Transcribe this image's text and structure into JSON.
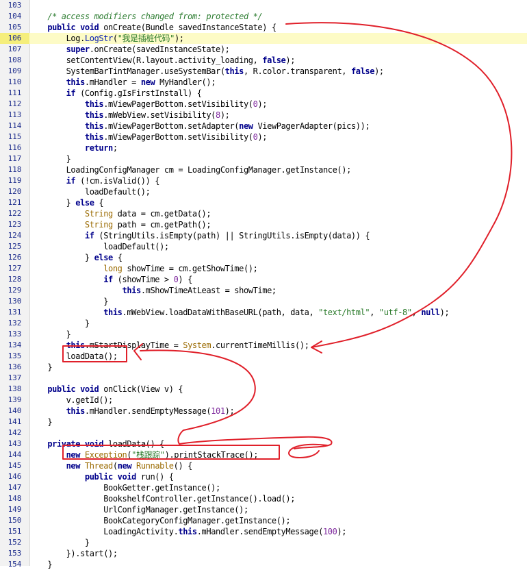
{
  "editor": {
    "highlighted_line": 106,
    "colors": {
      "annotation_red": "#e0202a",
      "highlight_line": "#fdfbc6",
      "keyword": "#00008b",
      "string": "#2a7a2a",
      "number": "#7f2a9e",
      "comment": "#2e7d32"
    },
    "lines": [
      {
        "n": "103",
        "indent": "",
        "tokens": []
      },
      {
        "n": "104",
        "indent": "    ",
        "tokens": [
          {
            "t": "/* access modifiers changed from: protected */",
            "c": "comment"
          }
        ]
      },
      {
        "n": "105",
        "indent": "    ",
        "tokens": [
          {
            "t": "public void",
            "c": "kw"
          },
          {
            "t": " onCreate(Bundle savedInstanceState) {",
            "c": "plain"
          }
        ]
      },
      {
        "n": "106",
        "indent": "        ",
        "tokens": [
          {
            "t": "Log.",
            "c": "plain"
          },
          {
            "t": "LogStr",
            "c": "field"
          },
          {
            "t": "(",
            "c": "plain"
          },
          {
            "t": "\"我是插桩代码\"",
            "c": "string"
          },
          {
            "t": ");",
            "c": "plain"
          }
        ]
      },
      {
        "n": "107",
        "indent": "        ",
        "tokens": [
          {
            "t": "super",
            "c": "kw"
          },
          {
            "t": ".onCreate(savedInstanceState);",
            "c": "plain"
          }
        ]
      },
      {
        "n": "108",
        "indent": "        ",
        "tokens": [
          {
            "t": "setContentView(R.layout.activity_loading, ",
            "c": "plain"
          },
          {
            "t": "false",
            "c": "kw"
          },
          {
            "t": ");",
            "c": "plain"
          }
        ]
      },
      {
        "n": "109",
        "indent": "        ",
        "tokens": [
          {
            "t": "SystemBarTintManager.useSystemBar(",
            "c": "plain"
          },
          {
            "t": "this",
            "c": "kw"
          },
          {
            "t": ", R.color.transparent, ",
            "c": "plain"
          },
          {
            "t": "false",
            "c": "kw"
          },
          {
            "t": ");",
            "c": "plain"
          }
        ]
      },
      {
        "n": "110",
        "indent": "        ",
        "tokens": [
          {
            "t": "this",
            "c": "kw"
          },
          {
            "t": ".mHandler = ",
            "c": "plain"
          },
          {
            "t": "new",
            "c": "kw"
          },
          {
            "t": " MyHandler();",
            "c": "plain"
          }
        ]
      },
      {
        "n": "111",
        "indent": "        ",
        "tokens": [
          {
            "t": "if",
            "c": "kw"
          },
          {
            "t": " (Config.gIsFirstInstall) {",
            "c": "plain"
          }
        ]
      },
      {
        "n": "112",
        "indent": "            ",
        "tokens": [
          {
            "t": "this",
            "c": "kw"
          },
          {
            "t": ".mViewPagerBottom.setVisibility(",
            "c": "plain"
          },
          {
            "t": "0",
            "c": "number"
          },
          {
            "t": ");",
            "c": "plain"
          }
        ]
      },
      {
        "n": "113",
        "indent": "            ",
        "tokens": [
          {
            "t": "this",
            "c": "kw"
          },
          {
            "t": ".mWebView.setVisibility(",
            "c": "plain"
          },
          {
            "t": "8",
            "c": "number"
          },
          {
            "t": ");",
            "c": "plain"
          }
        ]
      },
      {
        "n": "114",
        "indent": "            ",
        "tokens": [
          {
            "t": "this",
            "c": "kw"
          },
          {
            "t": ".mViewPagerBottom.setAdapter(",
            "c": "plain"
          },
          {
            "t": "new",
            "c": "kw"
          },
          {
            "t": " ViewPagerAdapter(pics));",
            "c": "plain"
          }
        ]
      },
      {
        "n": "115",
        "indent": "            ",
        "tokens": [
          {
            "t": "this",
            "c": "kw"
          },
          {
            "t": ".mViewPagerBottom.setVisibility(",
            "c": "plain"
          },
          {
            "t": "0",
            "c": "number"
          },
          {
            "t": ");",
            "c": "plain"
          }
        ]
      },
      {
        "n": "116",
        "indent": "            ",
        "tokens": [
          {
            "t": "return",
            "c": "kw"
          },
          {
            "t": ";",
            "c": "plain"
          }
        ]
      },
      {
        "n": "117",
        "indent": "        ",
        "tokens": [
          {
            "t": "}",
            "c": "plain"
          }
        ]
      },
      {
        "n": "118",
        "indent": "        ",
        "tokens": [
          {
            "t": "LoadingConfigManager cm = LoadingConfigManager.getInstance();",
            "c": "plain"
          }
        ]
      },
      {
        "n": "119",
        "indent": "        ",
        "tokens": [
          {
            "t": "if",
            "c": "kw"
          },
          {
            "t": " (!cm.isValid()) {",
            "c": "plain"
          }
        ]
      },
      {
        "n": "120",
        "indent": "            ",
        "tokens": [
          {
            "t": "loadDefault();",
            "c": "plain"
          }
        ]
      },
      {
        "n": "121",
        "indent": "        ",
        "tokens": [
          {
            "t": "} ",
            "c": "plain"
          },
          {
            "t": "else",
            "c": "kw"
          },
          {
            "t": " {",
            "c": "plain"
          }
        ]
      },
      {
        "n": "122",
        "indent": "            ",
        "tokens": [
          {
            "t": "String",
            "c": "type"
          },
          {
            "t": " data = cm.getData();",
            "c": "plain"
          }
        ]
      },
      {
        "n": "123",
        "indent": "            ",
        "tokens": [
          {
            "t": "String",
            "c": "type"
          },
          {
            "t": " path = cm.getPath();",
            "c": "plain"
          }
        ]
      },
      {
        "n": "124",
        "indent": "            ",
        "tokens": [
          {
            "t": "if",
            "c": "kw"
          },
          {
            "t": " (StringUtils.isEmpty(path) || StringUtils.isEmpty(data)) {",
            "c": "plain"
          }
        ]
      },
      {
        "n": "125",
        "indent": "                ",
        "tokens": [
          {
            "t": "loadDefault();",
            "c": "plain"
          }
        ]
      },
      {
        "n": "126",
        "indent": "            ",
        "tokens": [
          {
            "t": "} ",
            "c": "plain"
          },
          {
            "t": "else",
            "c": "kw"
          },
          {
            "t": " {",
            "c": "plain"
          }
        ]
      },
      {
        "n": "127",
        "indent": "                ",
        "tokens": [
          {
            "t": "long",
            "c": "type"
          },
          {
            "t": " showTime = cm.getShowTime();",
            "c": "plain"
          }
        ]
      },
      {
        "n": "128",
        "indent": "                ",
        "tokens": [
          {
            "t": "if",
            "c": "kw"
          },
          {
            "t": " (showTime > ",
            "c": "plain"
          },
          {
            "t": "0",
            "c": "number"
          },
          {
            "t": ") {",
            "c": "plain"
          }
        ]
      },
      {
        "n": "129",
        "indent": "                    ",
        "tokens": [
          {
            "t": "this",
            "c": "kw"
          },
          {
            "t": ".mShowTimeAtLeast = showTime;",
            "c": "plain"
          }
        ]
      },
      {
        "n": "130",
        "indent": "                ",
        "tokens": [
          {
            "t": "}",
            "c": "plain"
          }
        ]
      },
      {
        "n": "131",
        "indent": "                ",
        "tokens": [
          {
            "t": "this",
            "c": "kw"
          },
          {
            "t": ".mWebView.loadDataWithBaseURL(path, data, ",
            "c": "plain"
          },
          {
            "t": "\"text/html\"",
            "c": "string"
          },
          {
            "t": ", ",
            "c": "plain"
          },
          {
            "t": "\"utf-8\"",
            "c": "string"
          },
          {
            "t": ", ",
            "c": "plain"
          },
          {
            "t": "null",
            "c": "kw"
          },
          {
            "t": ");",
            "c": "plain"
          }
        ]
      },
      {
        "n": "132",
        "indent": "            ",
        "tokens": [
          {
            "t": "}",
            "c": "plain"
          }
        ]
      },
      {
        "n": "133",
        "indent": "        ",
        "tokens": [
          {
            "t": "}",
            "c": "plain"
          }
        ]
      },
      {
        "n": "134",
        "indent": "        ",
        "tokens": [
          {
            "t": "this",
            "c": "kw"
          },
          {
            "t": ".mStartDisplayTime = ",
            "c": "plain"
          },
          {
            "t": "System",
            "c": "type"
          },
          {
            "t": ".currentTimeMillis();",
            "c": "plain"
          }
        ]
      },
      {
        "n": "135",
        "indent": "        ",
        "tokens": [
          {
            "t": "loadData();",
            "c": "plain"
          }
        ]
      },
      {
        "n": "136",
        "indent": "    ",
        "tokens": [
          {
            "t": "}",
            "c": "plain"
          }
        ]
      },
      {
        "n": "137",
        "indent": "",
        "tokens": []
      },
      {
        "n": "138",
        "indent": "    ",
        "tokens": [
          {
            "t": "public void",
            "c": "kw"
          },
          {
            "t": " onClick(View v) {",
            "c": "plain"
          }
        ]
      },
      {
        "n": "139",
        "indent": "        ",
        "tokens": [
          {
            "t": "v.getId();",
            "c": "plain"
          }
        ]
      },
      {
        "n": "140",
        "indent": "        ",
        "tokens": [
          {
            "t": "this",
            "c": "kw"
          },
          {
            "t": ".mHandler.sendEmptyMessage(",
            "c": "plain"
          },
          {
            "t": "101",
            "c": "number"
          },
          {
            "t": ");",
            "c": "plain"
          }
        ]
      },
      {
        "n": "141",
        "indent": "    ",
        "tokens": [
          {
            "t": "}",
            "c": "plain"
          }
        ]
      },
      {
        "n": "142",
        "indent": "",
        "tokens": []
      },
      {
        "n": "143",
        "indent": "    ",
        "tokens": [
          {
            "t": "private void",
            "c": "kw"
          },
          {
            "t": " loadData() {",
            "c": "plain"
          }
        ]
      },
      {
        "n": "144",
        "indent": "        ",
        "tokens": [
          {
            "t": "new",
            "c": "kw"
          },
          {
            "t": " ",
            "c": "plain"
          },
          {
            "t": "Exception",
            "c": "type"
          },
          {
            "t": "(",
            "c": "plain"
          },
          {
            "t": "\"栈跟踪\"",
            "c": "string"
          },
          {
            "t": ").printStackTrace();",
            "c": "plain"
          }
        ]
      },
      {
        "n": "145",
        "indent": "        ",
        "tokens": [
          {
            "t": "new",
            "c": "kw"
          },
          {
            "t": " ",
            "c": "plain"
          },
          {
            "t": "Thread",
            "c": "type"
          },
          {
            "t": "(",
            "c": "plain"
          },
          {
            "t": "new",
            "c": "kw"
          },
          {
            "t": " ",
            "c": "plain"
          },
          {
            "t": "Runnable",
            "c": "type"
          },
          {
            "t": "() {",
            "c": "plain"
          }
        ]
      },
      {
        "n": "146",
        "indent": "            ",
        "tokens": [
          {
            "t": "public void",
            "c": "kw"
          },
          {
            "t": " run() {",
            "c": "plain"
          }
        ]
      },
      {
        "n": "147",
        "indent": "                ",
        "tokens": [
          {
            "t": "BookGetter.getInstance();",
            "c": "plain"
          }
        ]
      },
      {
        "n": "148",
        "indent": "                ",
        "tokens": [
          {
            "t": "BookshelfController.getInstance().load();",
            "c": "plain"
          }
        ]
      },
      {
        "n": "149",
        "indent": "                ",
        "tokens": [
          {
            "t": "UrlConfigManager.getInstance();",
            "c": "plain"
          }
        ]
      },
      {
        "n": "150",
        "indent": "                ",
        "tokens": [
          {
            "t": "BookCategoryConfigManager.getInstance();",
            "c": "plain"
          }
        ]
      },
      {
        "n": "151",
        "indent": "                ",
        "tokens": [
          {
            "t": "LoadingActivity.",
            "c": "plain"
          },
          {
            "t": "this",
            "c": "kw"
          },
          {
            "t": ".mHandler.sendEmptyMessage(",
            "c": "plain"
          },
          {
            "t": "100",
            "c": "number"
          },
          {
            "t": ");",
            "c": "plain"
          }
        ]
      },
      {
        "n": "152",
        "indent": "            ",
        "tokens": [
          {
            "t": "}",
            "c": "plain"
          }
        ]
      },
      {
        "n": "153",
        "indent": "        ",
        "tokens": [
          {
            "t": "}).start();",
            "c": "plain"
          }
        ]
      },
      {
        "n": "154",
        "indent": "    ",
        "tokens": [
          {
            "t": "}",
            "c": "plain"
          }
        ]
      }
    ]
  }
}
